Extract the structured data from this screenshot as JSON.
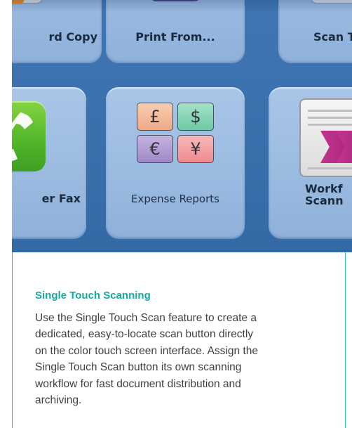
{
  "tiles_top": [
    {
      "label": "rd Copy",
      "icon": "copy-icon"
    },
    {
      "label": "Print From...",
      "icon": "print-from-icon"
    },
    {
      "label": "Scan T",
      "icon": "scan-icon"
    }
  ],
  "tiles_middle": [
    {
      "label": "er Fax",
      "icon": "fax-phone-icon"
    },
    {
      "label": "Expense Reports",
      "icon": "currency-icon",
      "symbols": [
        "£",
        "$",
        "€",
        "¥"
      ]
    },
    {
      "label_line1": "Workf",
      "label_line2": "Scann",
      "icon": "workflow-document-icon"
    }
  ],
  "info": {
    "title": "Single Touch Scanning",
    "body": "Use the Single Touch Scan feature to create a dedicated, easy-to-locate scan button directly on the color touch screen interface. Assign the Single Touch Scan button its own scanning workflow for fast document distribution and archiving."
  },
  "colors": {
    "screen_bg": "#3a6fac",
    "tile": "#9ebde2",
    "accent_teal": "#15a9a2"
  }
}
